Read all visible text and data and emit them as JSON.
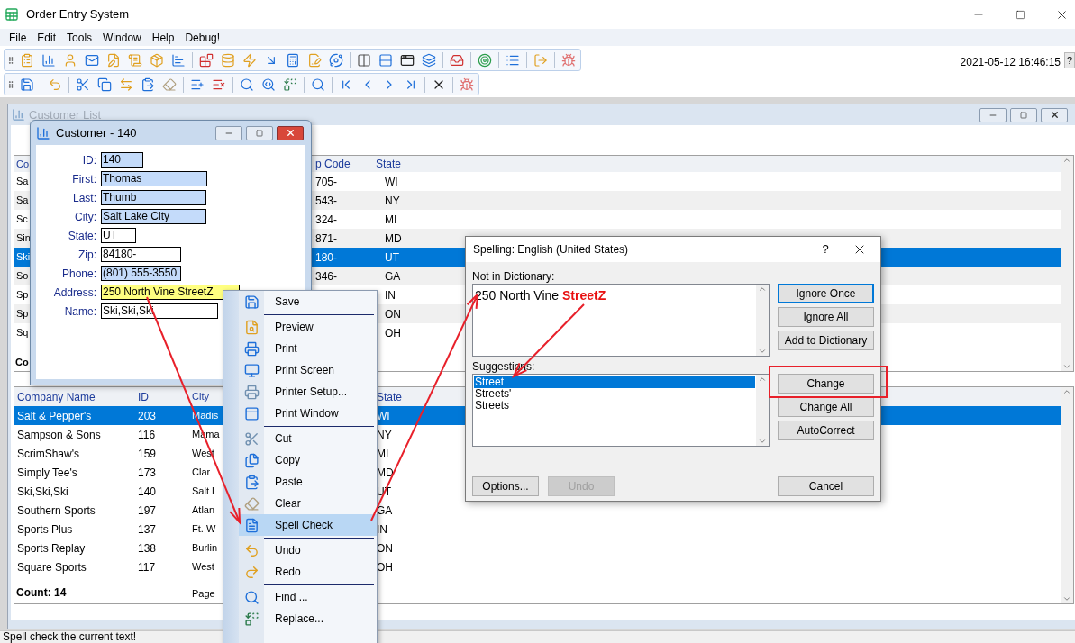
{
  "window": {
    "title": "Order Entry System"
  },
  "menu_bar": [
    "File",
    "Edit",
    "Tools",
    "Window",
    "Help",
    "Debug!"
  ],
  "clock": "2021-05-12 16:46:15",
  "help_button": "?",
  "customer_list": {
    "title": "Customer List",
    "top_grid": {
      "columns": [
        "Co",
        "p Code",
        "State"
      ],
      "rows": [
        {
          "column_1": "Sa",
          "zip": "705-",
          "state": "WI",
          "selected": false
        },
        {
          "column_1": "Sa",
          "zip": "543-",
          "state": "NY",
          "selected": false
        },
        {
          "column_1": "Sc",
          "zip": "324-",
          "state": "MI",
          "selected": false
        },
        {
          "column_1": "Sin",
          "zip": "871-",
          "state": "MD",
          "selected": false
        },
        {
          "column_1": "Ski",
          "zip": "180-",
          "state": "UT",
          "selected": true
        },
        {
          "column_1": "So",
          "zip": "346-",
          "state": "GA",
          "selected": false
        },
        {
          "column_1": "Sp",
          "state": "IN",
          "selected": false
        },
        {
          "column_1": "Sp",
          "state": "ON",
          "selected": false
        },
        {
          "column_1": "Sq",
          "state": "OH",
          "selected": false
        }
      ],
      "footer": "Co"
    },
    "bottom_grid": {
      "columns": [
        "Company Name",
        "ID",
        "City",
        "State"
      ],
      "rows": [
        {
          "company": "Salt & Pepper's",
          "id": "203",
          "city": "Madis",
          "state": "WI",
          "selected": true
        },
        {
          "company": "Sampson & Sons",
          "id": "116",
          "city": "Mama",
          "state": "NY",
          "selected": false
        },
        {
          "company": "ScrimShaw's",
          "id": "159",
          "city": "West",
          "state": "MI",
          "selected": false
        },
        {
          "company": "Simply Tee's",
          "id": "173",
          "city": "Clar",
          "state": "MD",
          "selected": false
        },
        {
          "company": "Ski,Ski,Ski",
          "id": "140",
          "city": "Salt L",
          "state": "UT",
          "selected": false
        },
        {
          "company": "Southern Sports",
          "id": "197",
          "city": "Atlan",
          "state": "GA",
          "selected": false
        },
        {
          "company": "Sports Plus",
          "id": "137",
          "city": "Ft. W",
          "state": "IN",
          "selected": false
        },
        {
          "company": "Sports Replay",
          "id": "138",
          "city": "Burlin",
          "state": "ON",
          "selected": false
        },
        {
          "company": "Square Sports",
          "id": "117",
          "city": "West",
          "state": "OH",
          "selected": false
        }
      ],
      "count": "Count: 14",
      "page": "Page"
    }
  },
  "customer_dialog": {
    "title": "Customer - 140",
    "fields": [
      {
        "label": "ID:",
        "value": "140",
        "kind": "highlighted"
      },
      {
        "label": "First:",
        "value": "Thomas",
        "kind": "highlighted"
      },
      {
        "label": "Last:",
        "value": "Thumb",
        "kind": "highlighted"
      },
      {
        "label": "City:",
        "value": "Salt Lake City",
        "kind": "highlighted"
      },
      {
        "label": "State:",
        "value": "UT",
        "kind": "plain"
      },
      {
        "label": "Zip:",
        "value": "84180-",
        "kind": "plain"
      },
      {
        "label": "Phone:",
        "value": "(801) 555-3550",
        "kind": "highlighted"
      },
      {
        "label": "Address:",
        "value": "250 North Vine StreetZ",
        "kind": "focused"
      },
      {
        "label": "Name:",
        "value": "Ski,Ski,Ski",
        "kind": "plain"
      }
    ]
  },
  "context_menu": {
    "groups": [
      [
        {
          "label": "Save",
          "selected": false
        }
      ],
      [
        {
          "label": "Preview",
          "selected": false
        },
        {
          "label": "Print",
          "selected": false
        },
        {
          "label": "Print Screen",
          "selected": false
        },
        {
          "label": "Printer Setup...",
          "selected": false
        },
        {
          "label": "Print Window",
          "selected": false
        }
      ],
      [
        {
          "label": "Cut",
          "selected": false
        },
        {
          "label": "Copy",
          "selected": false
        },
        {
          "label": "Paste",
          "selected": false
        },
        {
          "label": "Clear",
          "selected": false
        },
        {
          "label": "Spell Check",
          "selected": true
        }
      ],
      [
        {
          "label": "Undo",
          "selected": false
        },
        {
          "label": "Redo",
          "selected": false
        }
      ],
      [
        {
          "label": "Find ...",
          "selected": false
        },
        {
          "label": "Replace...",
          "selected": false
        }
      ]
    ]
  },
  "spelling_dialog": {
    "title": "Spelling: English (United States)",
    "help": "?",
    "not_in_dictionary_label": "Not in Dictionary:",
    "sentence": "250 North Vine ",
    "misspelled": "StreetZ",
    "suggestions_label": "Suggestions:",
    "suggestions": [
      {
        "text": "Street",
        "selected": true
      },
      {
        "text": "Streets'",
        "selected": false
      },
      {
        "text": "Streets",
        "selected": false
      }
    ],
    "top_buttons": [
      {
        "label": "Ignore Once",
        "default": true,
        "disabled": false
      },
      {
        "label": "Ignore All",
        "default": false,
        "disabled": false
      },
      {
        "label": "Add to Dictionary",
        "default": false,
        "disabled": false
      }
    ],
    "middle_buttons": [
      {
        "label": "Change",
        "default": false,
        "disabled": false
      },
      {
        "label": "Change All",
        "default": false,
        "disabled": false
      },
      {
        "label": "AutoCorrect",
        "default": false,
        "disabled": false
      }
    ],
    "bottom_buttons": [
      {
        "label": "Options...",
        "default": false,
        "disabled": false
      },
      {
        "label": "Undo",
        "default": false,
        "disabled": true
      }
    ],
    "cancel_button": {
      "label": "Cancel",
      "default": false,
      "disabled": false
    }
  },
  "status_bar": "Spell check the current text!"
}
